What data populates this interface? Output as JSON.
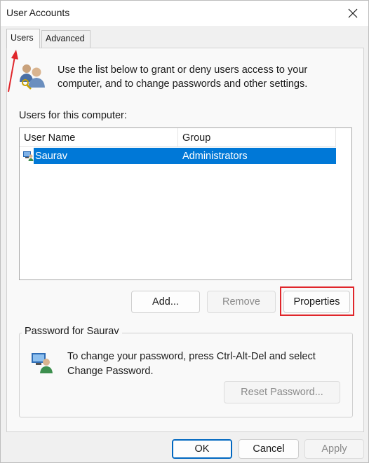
{
  "window": {
    "title": "User Accounts"
  },
  "tabs": [
    {
      "label": "Users",
      "active": true
    },
    {
      "label": "Advanced",
      "active": false
    }
  ],
  "intro_text": "Use the list below to grant or deny users access to your computer, and to change passwords and other settings.",
  "users_list": {
    "label": "Users for this computer:",
    "columns": [
      "User Name",
      "Group"
    ],
    "rows": [
      {
        "user": "Saurav",
        "group": "Administrators",
        "selected": true
      }
    ]
  },
  "list_buttons": {
    "add": "Add...",
    "remove": "Remove",
    "properties": "Properties"
  },
  "password_group": {
    "title": "Password for Saurav",
    "text": "To change your password, press Ctrl-Alt-Del and select Change Password.",
    "reset_label": "Reset Password..."
  },
  "footer": {
    "ok": "OK",
    "cancel": "Cancel",
    "apply": "Apply"
  },
  "colors": {
    "selection": "#0078d7",
    "annotation": "#e0262b",
    "primary_border": "#0067c0"
  },
  "icons": {
    "close": "close-icon",
    "users": "users-icon",
    "user_row": "user-computer-icon",
    "password": "user-password-icon"
  }
}
